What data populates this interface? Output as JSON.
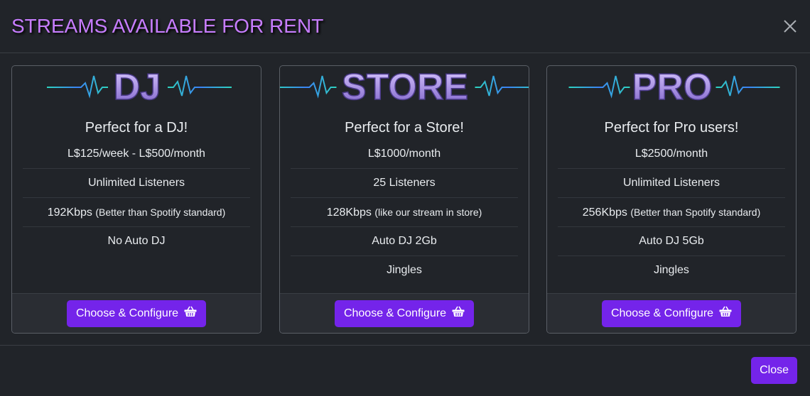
{
  "modal": {
    "title": "STREAMS AVAILABLE FOR RENT",
    "close_icon": "close-icon",
    "footer_close_label": "Close"
  },
  "colors": {
    "accent": "#7424ea",
    "title": "#c77dff",
    "background": "#212429",
    "logo_text_gradient": [
      "#d9c8ff",
      "#7d62c9"
    ],
    "wave_line": [
      "#3b82f6",
      "#2dd4bf"
    ]
  },
  "plans": [
    {
      "logo_text": "DJ",
      "heading": "Perfect for a DJ!",
      "features": [
        {
          "main": "L$125/week - L$500/month",
          "note": ""
        },
        {
          "main": "Unlimited Listeners",
          "note": ""
        },
        {
          "main": "192Kbps",
          "note": "(Better than Spotify standard)"
        },
        {
          "main": "No Auto DJ",
          "note": ""
        }
      ],
      "button_label": "Choose & Configure",
      "button_icon": "basket-icon"
    },
    {
      "logo_text": "STORE",
      "heading": "Perfect for a Store!",
      "features": [
        {
          "main": "L$1000/month",
          "note": ""
        },
        {
          "main": "25 Listeners",
          "note": ""
        },
        {
          "main": "128Kbps",
          "note": "(like our stream in store)"
        },
        {
          "main": "Auto DJ 2Gb",
          "note": ""
        },
        {
          "main": "Jingles",
          "note": ""
        }
      ],
      "button_label": "Choose & Configure",
      "button_icon": "basket-icon"
    },
    {
      "logo_text": "PRO",
      "heading": "Perfect for Pro users!",
      "features": [
        {
          "main": "L$2500/month",
          "note": ""
        },
        {
          "main": "Unlimited Listeners",
          "note": ""
        },
        {
          "main": "256Kbps",
          "note": "(Better than Spotify standard)"
        },
        {
          "main": "Auto DJ 5Gb",
          "note": ""
        },
        {
          "main": "Jingles",
          "note": ""
        }
      ],
      "button_label": "Choose & Configure",
      "button_icon": "basket-icon"
    }
  ]
}
